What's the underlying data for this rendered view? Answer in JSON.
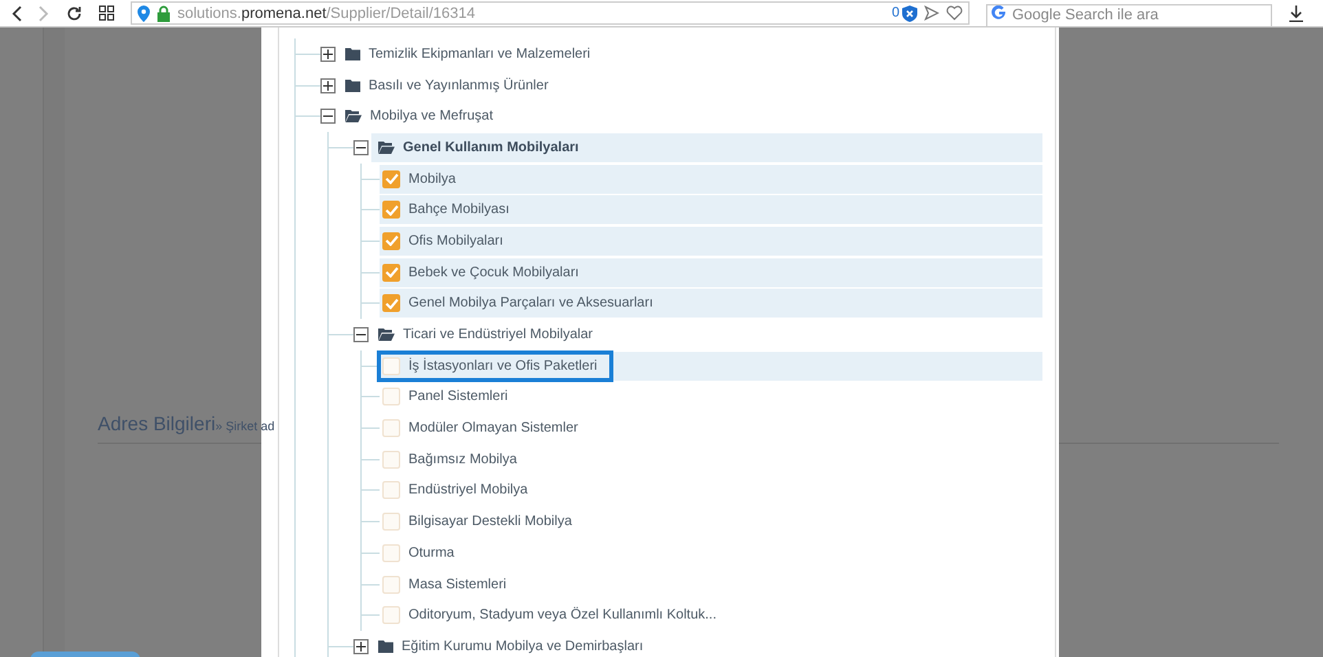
{
  "browser": {
    "url_prefix": "solutions.",
    "url_domain": "promena.net",
    "url_path": "/Supplier/Detail/16314",
    "badge": "0",
    "search_placeholder": "Google Search ile ara"
  },
  "background": {
    "heading": "Adres Bilgileri",
    "breadcrumb": "» Şirket ad"
  },
  "tree": {
    "items": [
      {
        "label": "Temizlik Ekipmanları ve Malzemeleri",
        "expanded": false,
        "selected": false
      },
      {
        "label": "Basılı ve Yayınlanmış Ürünler",
        "expanded": false,
        "selected": false
      },
      {
        "label": "Mobilya ve Mefruşat",
        "expanded": true,
        "selected": false,
        "children": [
          {
            "label": "Genel Kullanım Mobilyaları",
            "expanded": true,
            "selected": true,
            "children": [
              {
                "label": "Mobilya",
                "checked": true,
                "selected": true,
                "focused": false
              },
              {
                "label": "Bahçe Mobilyası",
                "checked": true,
                "selected": true,
                "focused": false
              },
              {
                "label": "Ofis Mobilyaları",
                "checked": true,
                "selected": true,
                "focused": false
              },
              {
                "label": "Bebek ve Çocuk Mobilyaları",
                "checked": true,
                "selected": true,
                "focused": false
              },
              {
                "label": "Genel Mobilya Parçaları ve Aksesuarları",
                "checked": true,
                "selected": true,
                "focused": false
              }
            ]
          },
          {
            "label": "Ticari ve Endüstriyel Mobilyalar",
            "expanded": true,
            "selected": false,
            "children": [
              {
                "label": "İş İstasyonları ve Ofis Paketleri",
                "checked": false,
                "selected": true,
                "focused": true
              },
              {
                "label": "Panel Sistemleri",
                "checked": false,
                "selected": false,
                "focused": false
              },
              {
                "label": "Modüler Olmayan Sistemler",
                "checked": false,
                "selected": false,
                "focused": false
              },
              {
                "label": "Bağımsız Mobilya",
                "checked": false,
                "selected": false,
                "focused": false
              },
              {
                "label": "Endüstriyel Mobilya",
                "checked": false,
                "selected": false,
                "focused": false
              },
              {
                "label": "Bilgisayar Destekli Mobilya",
                "checked": false,
                "selected": false,
                "focused": false
              },
              {
                "label": "Oturma",
                "checked": false,
                "selected": false,
                "focused": false
              },
              {
                "label": "Masa Sistemleri",
                "checked": false,
                "selected": false,
                "focused": false
              },
              {
                "label": "Oditoryum, Stadyum veya Özel Kullanımlı Koltuk...",
                "checked": false,
                "selected": false,
                "focused": false
              }
            ]
          },
          {
            "label": "Eğitim Kurumu Mobilya ve Demirbaşları",
            "expanded": false,
            "selected": false
          }
        ]
      }
    ]
  }
}
